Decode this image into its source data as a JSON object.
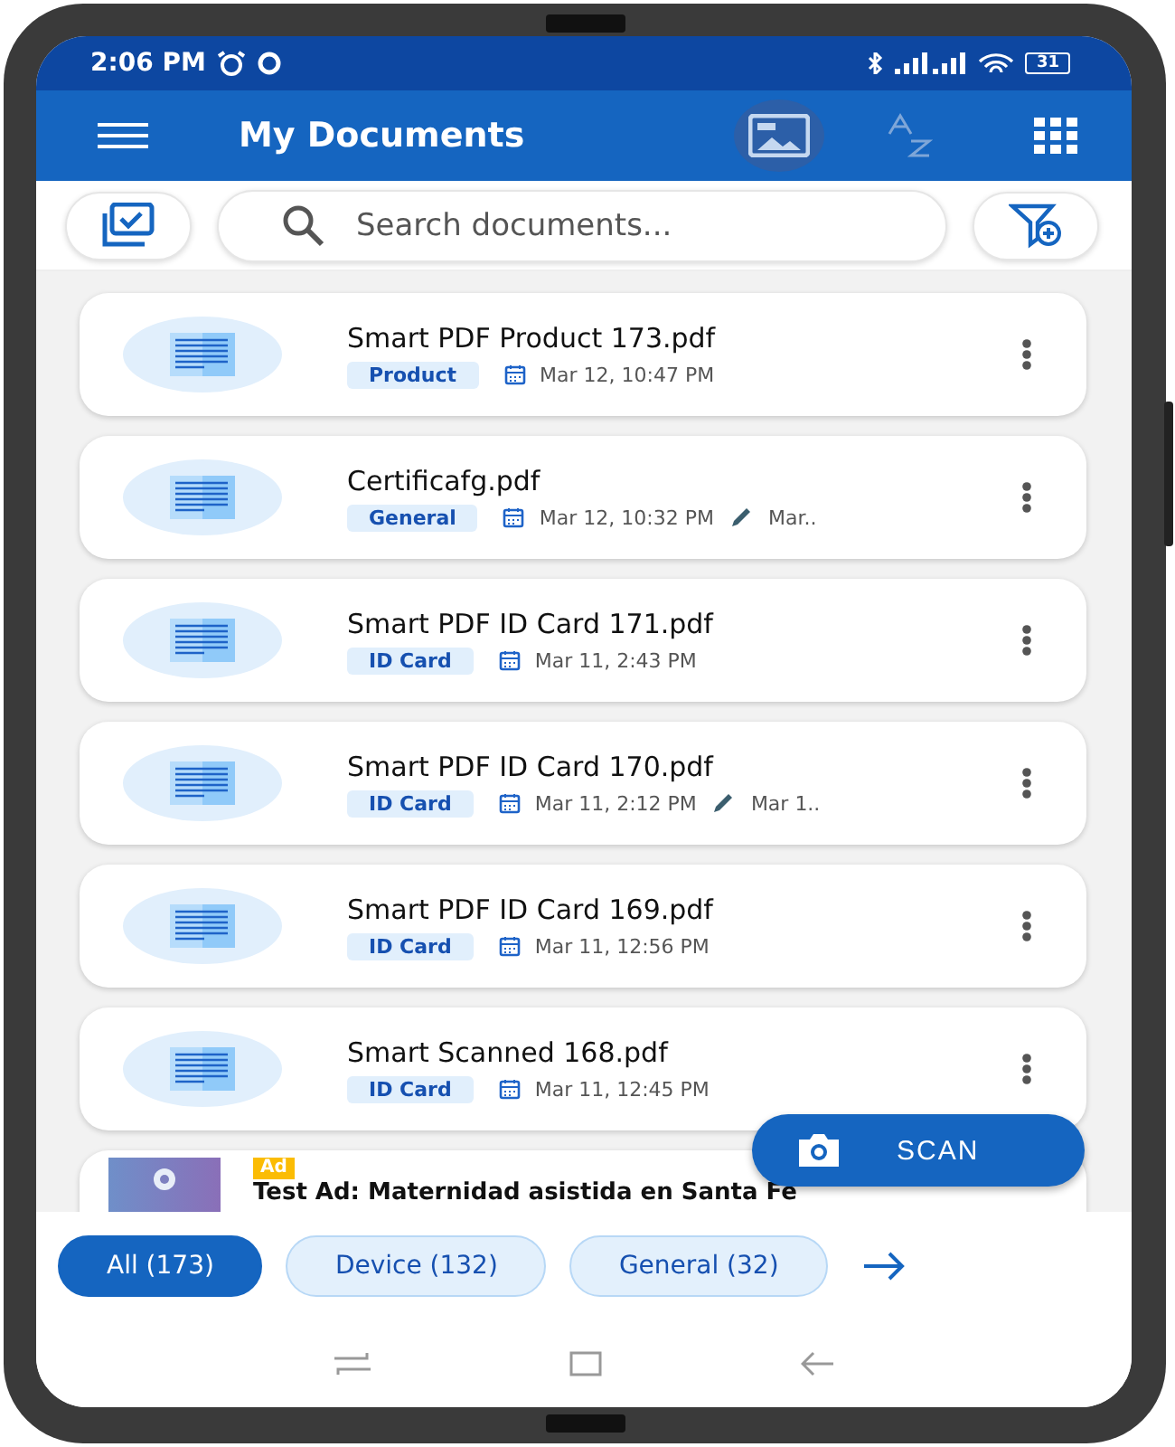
{
  "status_bar": {
    "time": "2:06 PM",
    "battery": "31"
  },
  "app_bar": {
    "title": "My Documents"
  },
  "search": {
    "placeholder": "Search documents..."
  },
  "documents": [
    {
      "title": "Smart PDF Product 173.pdf",
      "tag": "Product",
      "date": "Mar 12, 10:47 PM"
    },
    {
      "title": "Certificafg.pdf",
      "tag": "General",
      "date": "Mar 12, 10:32 PM",
      "edited": "Mar.."
    },
    {
      "title": "Smart PDF ID Card 171.pdf",
      "tag": "ID Card",
      "date": "Mar 11, 2:43 PM"
    },
    {
      "title": "Smart PDF ID Card 170.pdf",
      "tag": "ID Card",
      "date": "Mar 11, 2:12 PM",
      "edited": "Mar 1.."
    },
    {
      "title": "Smart PDF ID Card 169.pdf",
      "tag": "ID Card",
      "date": "Mar 11, 12:56 PM"
    },
    {
      "title": "Smart Scanned 168.pdf",
      "tag": "ID Card",
      "date": "Mar 11, 12:45 PM"
    }
  ],
  "ad": {
    "badge": "Ad",
    "title": "Test Ad: Maternidad asistida en Santa Fe"
  },
  "fab": {
    "label": "SCAN"
  },
  "filters": [
    {
      "label": "All (173)",
      "selected": true
    },
    {
      "label": "Device (132)",
      "selected": false
    },
    {
      "label": "General (32)",
      "selected": false
    }
  ]
}
